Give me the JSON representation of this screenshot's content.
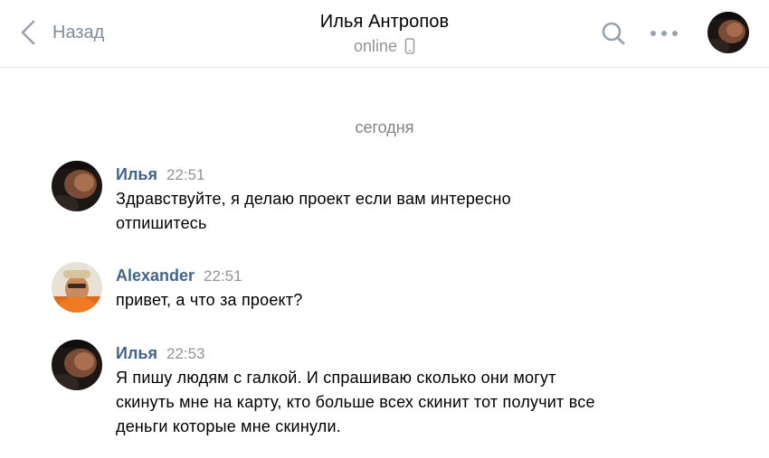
{
  "header": {
    "back_label": "Назад",
    "title": "Илья Антропов",
    "status": "online",
    "icons": {
      "back": "chevron-left-icon",
      "device": "mobile-phone-icon",
      "search": "search-icon",
      "more": "more-horizontal-icon"
    }
  },
  "date_separator": "сегодня",
  "messages": [
    {
      "author": "Илья",
      "time": "22:51",
      "lines": [
        "Здравствуйте, я делаю проект если вам интересно",
        "отпишитесь"
      ]
    },
    {
      "author": "Alexander",
      "time": "22:51",
      "lines": [
        "привет, а что за проект?"
      ]
    },
    {
      "author": "Илья",
      "time": "22:53",
      "lines": [
        "Я пишу людям с галкой. И спрашиваю сколько они могут",
        "скинуть мне на карту, кто больше всех скинит тот получит все",
        "деньги которые мне скинули."
      ]
    }
  ],
  "colors": {
    "author_link": "#42648b",
    "secondary_text": "#939393",
    "icon_gray": "#99a2ad",
    "divider": "#e7e8ec"
  }
}
